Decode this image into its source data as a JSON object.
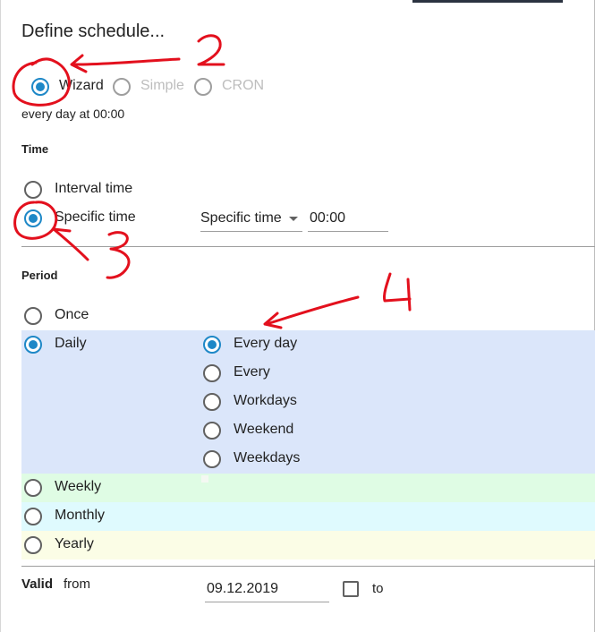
{
  "dialog": {
    "title": "Define schedule..."
  },
  "mode": {
    "options": [
      {
        "label": "Wizard",
        "selected": true,
        "enabled": true
      },
      {
        "label": "Simple",
        "selected": false,
        "enabled": false
      },
      {
        "label": "CRON",
        "selected": false,
        "enabled": false
      }
    ]
  },
  "summary": "every day at 00:00",
  "time": {
    "heading": "Time",
    "options": [
      {
        "label": "Interval time",
        "selected": false
      },
      {
        "label": "Specific time",
        "selected": true
      }
    ],
    "select_value": "Specific time",
    "time_value": "00:00"
  },
  "period": {
    "heading": "Period",
    "options": [
      {
        "label": "Once",
        "selected": false
      },
      {
        "label": "Daily",
        "selected": true,
        "color": "#dbe6fa"
      },
      {
        "label": "Weekly",
        "selected": false,
        "color": "#dffce4"
      },
      {
        "label": "Monthly",
        "selected": false,
        "color": "#dffafe"
      },
      {
        "label": "Yearly",
        "selected": false,
        "color": "#fbfde6"
      }
    ],
    "daily_options": [
      {
        "label": "Every day",
        "selected": true
      },
      {
        "label": "Every",
        "selected": false
      },
      {
        "label": "Workdays",
        "selected": false
      },
      {
        "label": "Weekend",
        "selected": false
      },
      {
        "label": "Weekdays",
        "selected": false
      }
    ]
  },
  "valid": {
    "label": "Valid",
    "from_label": "from",
    "from_value": "09.12.2019",
    "to_label": "to",
    "to_checked": false
  },
  "annotations": {
    "color": "#e3101d",
    "marks": [
      "2",
      "3",
      "4"
    ]
  },
  "accent_color": "#1e88c7"
}
